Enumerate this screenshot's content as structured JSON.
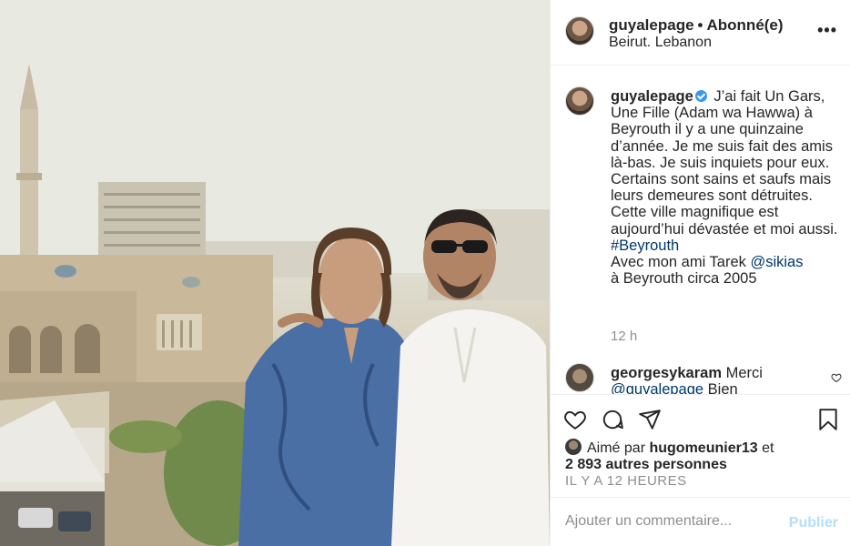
{
  "post": {
    "photo_description_icon": "photo",
    "header": {
      "username": "guyalepage",
      "separator": "•",
      "follow_state": "Abonné(e)",
      "location": "Beirut. Lebanon",
      "more_icon": "more-horizontal-icon",
      "more_label": "•••"
    },
    "caption": {
      "username": "guyalepage",
      "verified": true,
      "text_before": "J’ai fait Un Gars, Une Fille (Adam wa Hawwa) à Beyrouth il y a une quinzaine d’année. Je me suis fait des amis là-bas. Je suis inquiets pour eux. Certains sont sains et saufs mais leurs demeures sont détruites. Cette ville magnifique est aujourd’hui dévastée et moi aussi.",
      "hashtag": "#Beyrouth",
      "text_mid": "Avec mon ami Tarek",
      "mention": "@sikias",
      "text_after": "à Beyrouth circa 2005",
      "time": "12 h"
    },
    "comment": {
      "username": "georgesykaram",
      "text": "Merci",
      "mention": "@guyalepage",
      "rest": " Bien"
    },
    "actions": {
      "like_icon": "heart-icon",
      "comment_icon": "comment-icon",
      "share_icon": "send-icon",
      "save_icon": "bookmark-icon"
    },
    "likes": {
      "prefix": "Aimé par",
      "user": "hugomeunier13",
      "connector": "et",
      "others": "2 893 autres personnes"
    },
    "time_ago": "IL Y A 12 HEURES",
    "add_comment": {
      "placeholder": "Ajouter un commentaire...",
      "publish": "Publier"
    },
    "colors": {
      "link": "#00376b",
      "muted": "#8e8e8e",
      "publish_disabled": "#b2dffc",
      "verified": "#3897f0"
    }
  }
}
